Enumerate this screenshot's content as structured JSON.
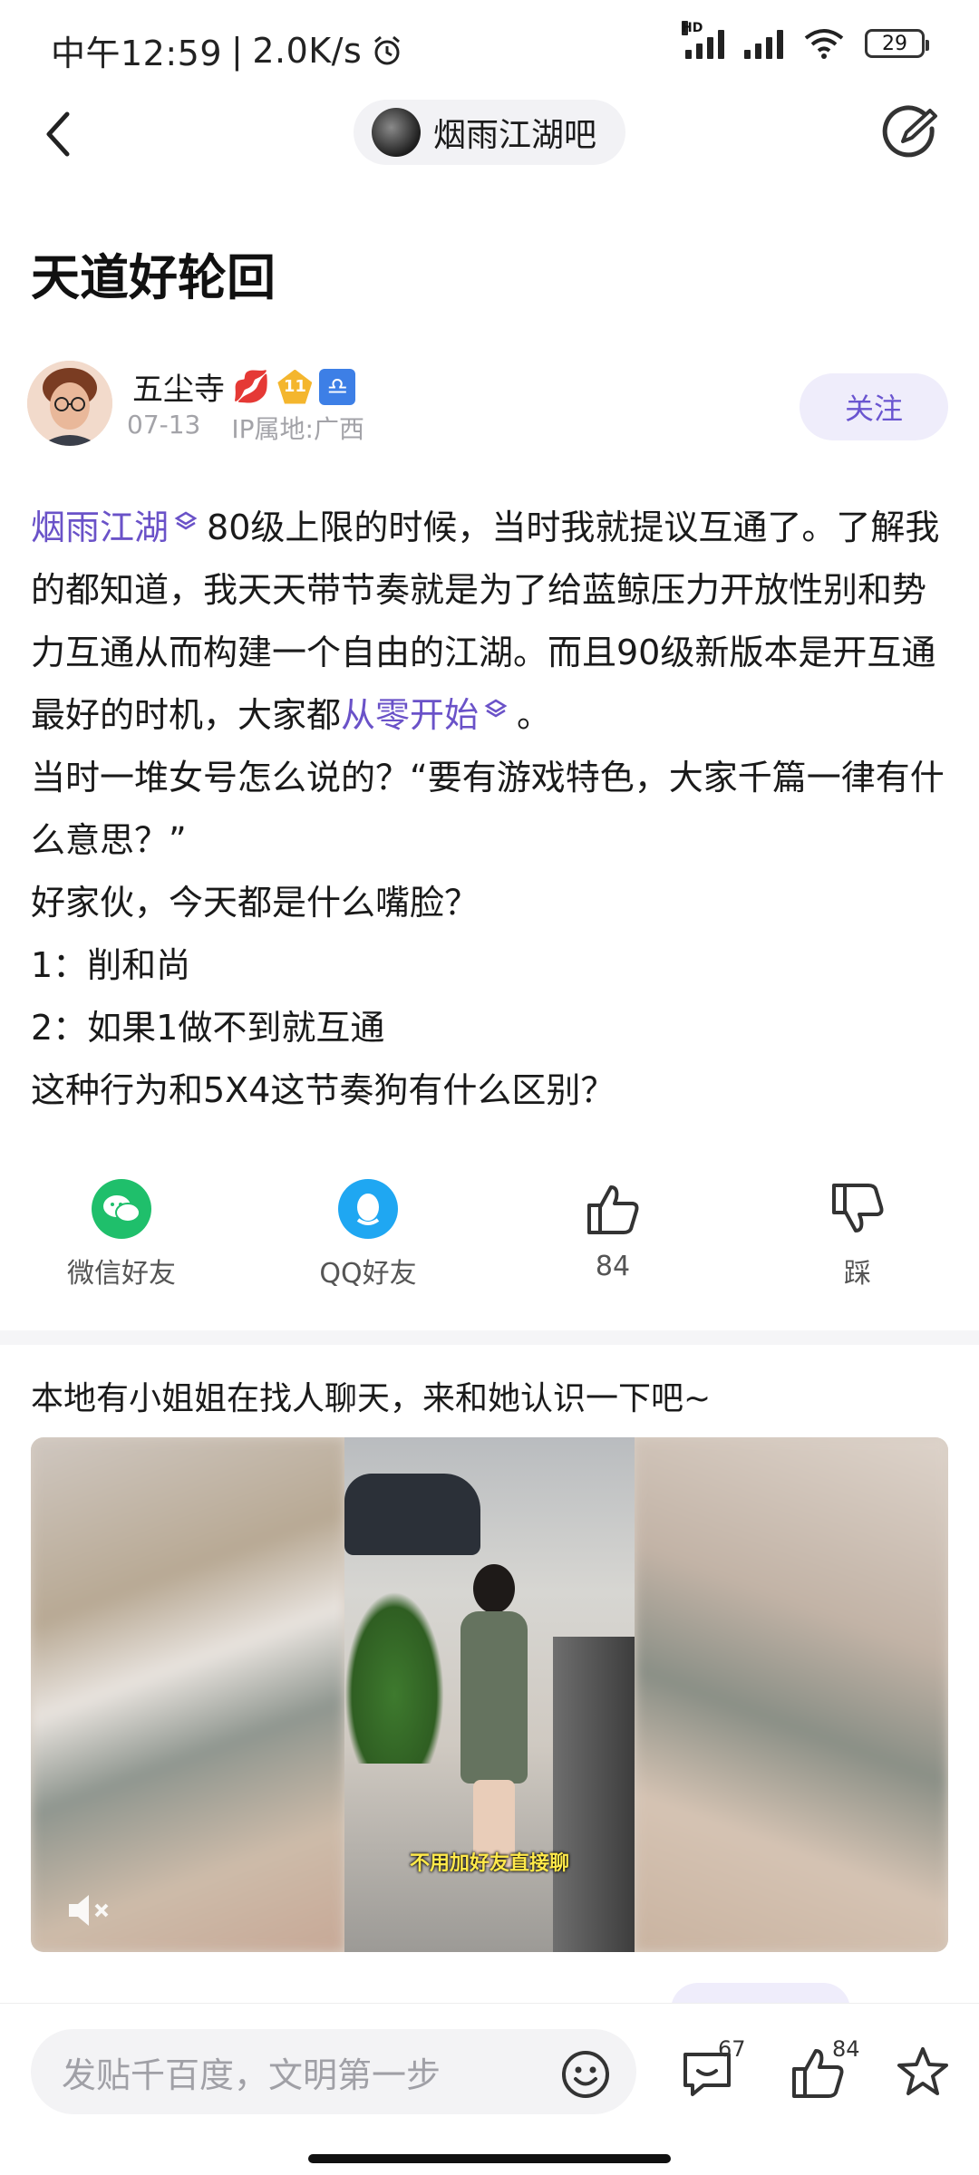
{
  "status_bar": {
    "time": "中午12:59",
    "speed": "2.0K/s",
    "network_label": "HD",
    "battery": "29"
  },
  "nav": {
    "forum_name": "烟雨江湖吧"
  },
  "post": {
    "title": "天道好轮回",
    "author": {
      "name": "五尘寺",
      "level": "11",
      "date": "07-13",
      "ip": "IP属地:广西",
      "follow_label": "关注"
    },
    "body": {
      "link1": "烟雨江湖",
      "p1_after_link": "80级上限的时候，当时我就提议互通了。了解我的都知道，我天天带节奏就是为了给蓝鲸压力开放性别和势力互通从而构建一个自由的江湖。而且90级新版本是开互通最好的时机，大家都",
      "link2": "从零开始",
      "p1_end": "。",
      "p2": "当时一堆女号怎么说的？“要有游戏特色，大家千篇一律有什么意思？”",
      "p3": "好家伙，今天都是什么嘴脸？",
      "p4": "1：削和尚",
      "p5": "2：如果1做不到就互通",
      "p6": "这种行为和5X4这节奏狗有什么区别？"
    }
  },
  "actions": {
    "wechat": "微信好友",
    "qq": "QQ好友",
    "likes": "84",
    "dislike": "踩"
  },
  "ad": {
    "title": "本地有小姐姐在找人聊天，来和她认识一下吧~",
    "caption": "不用加好友直接聊"
  },
  "bottom_bar": {
    "input_placeholder": "发贴千百度，文明第一步",
    "comment_count": "67",
    "like_count": "84"
  },
  "colors": {
    "accent": "#6a52c8",
    "follow_bg": "#efedfb",
    "wechat": "#1fbf6b",
    "qq": "#1fa7f2"
  }
}
